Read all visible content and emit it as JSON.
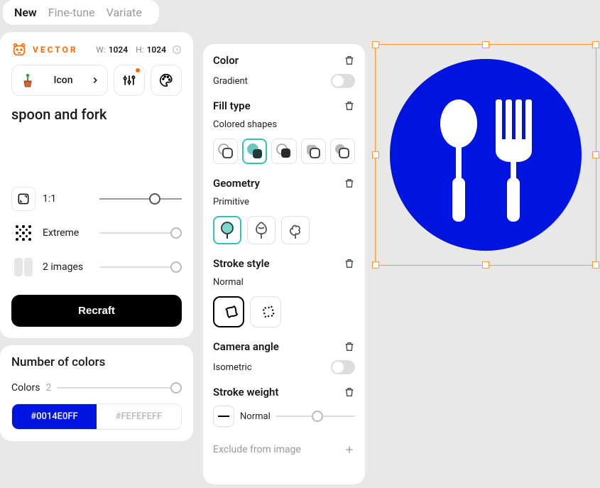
{
  "tabs": {
    "new": "New",
    "finetune": "Fine-tune",
    "variate": "Variate",
    "active": "new"
  },
  "vector": {
    "label": "VECTOR",
    "width_label": "W:",
    "width": "1024",
    "height_label": "H:",
    "height": "1024"
  },
  "icon_chip": {
    "label": "Icon"
  },
  "prompt": "spoon and fork",
  "options": {
    "aspect": "1:1",
    "complexity": "Extreme",
    "count": "2 images"
  },
  "recraft_btn": "Recraft",
  "colors": {
    "heading": "Number of colors",
    "label": "Colors",
    "count": "2",
    "swatches": [
      "#0014E0FF",
      "#FEFEFEFF"
    ]
  },
  "mid": {
    "color": {
      "title": "Color",
      "gradient": "Gradient"
    },
    "fill": {
      "title": "Fill type",
      "sub": "Colored shapes"
    },
    "geometry": {
      "title": "Geometry",
      "sub": "Primitive"
    },
    "stroke_style": {
      "title": "Stroke style",
      "sub": "Normal"
    },
    "camera": {
      "title": "Camera angle",
      "sub": "Isometric"
    },
    "stroke_weight": {
      "title": "Stroke weight",
      "sub": "Normal"
    },
    "exclude": "Exclude from image"
  },
  "output": {
    "bg_color": "#0014e0",
    "fg_color": "#ffffff"
  }
}
